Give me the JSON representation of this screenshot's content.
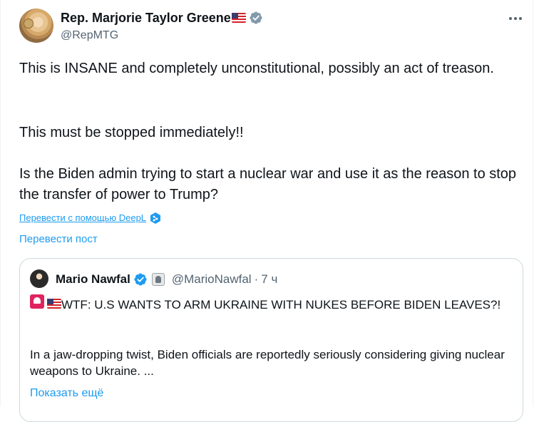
{
  "author": {
    "name": "Rep. Marjorie Taylor Greene",
    "handle": "@RepMTG",
    "flag_icon": "us-flag-icon",
    "verified_icon": "verified-badge-icon"
  },
  "tweet": {
    "paragraph_1": "This is INSANE and completely unconstitutional, possibly an act of treason.",
    "paragraph_2": "This must be stopped immediately!!",
    "paragraph_3": "Is the Biden admin trying to start a nuclear war and use it as the reason to stop the transfer of power to Trump?"
  },
  "translation": {
    "deepl_label": "Перевести с помощью DeepL",
    "translate_post_label": "Перевести пост"
  },
  "quoted": {
    "name": "Mario Nawfal",
    "handle": "@MarioNawfal",
    "separator": "·",
    "time": "7 ч",
    "headline": "WTF: U.S WANTS TO ARM UKRAINE WITH NUKES BEFORE BIDEN LEAVES?!",
    "body": "In a jaw-dropping twist,  Biden officials are reportedly seriously considering giving nuclear weapons to Ukraine. ...",
    "show_more": "Показать ещё"
  },
  "colors": {
    "link": "#1d9bf0",
    "secondary_text": "#536471",
    "verified": "#829aab",
    "border": "#cfd9de"
  }
}
